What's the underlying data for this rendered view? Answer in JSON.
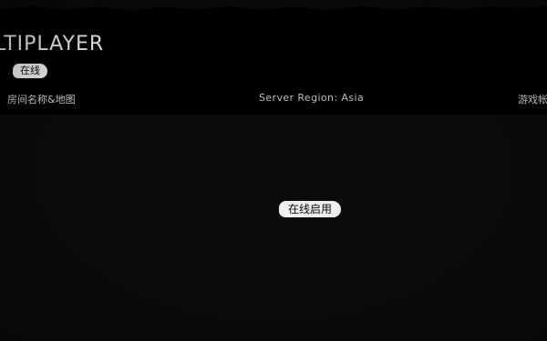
{
  "header": {
    "title": "LTIPLAYER",
    "status_tag": "在线"
  },
  "columns": {
    "left": "房间名称&地图",
    "center": "Server Region: Asia",
    "right": "游戏帐"
  },
  "main": {
    "enable_online_button": "在线启用"
  },
  "colors": {
    "background": "#0b0b0c",
    "header_bg": "#000000",
    "tag_bg": "#f1f1f1",
    "text_primary": "#f2f2f2",
    "text_secondary": "#c7c7c7"
  }
}
